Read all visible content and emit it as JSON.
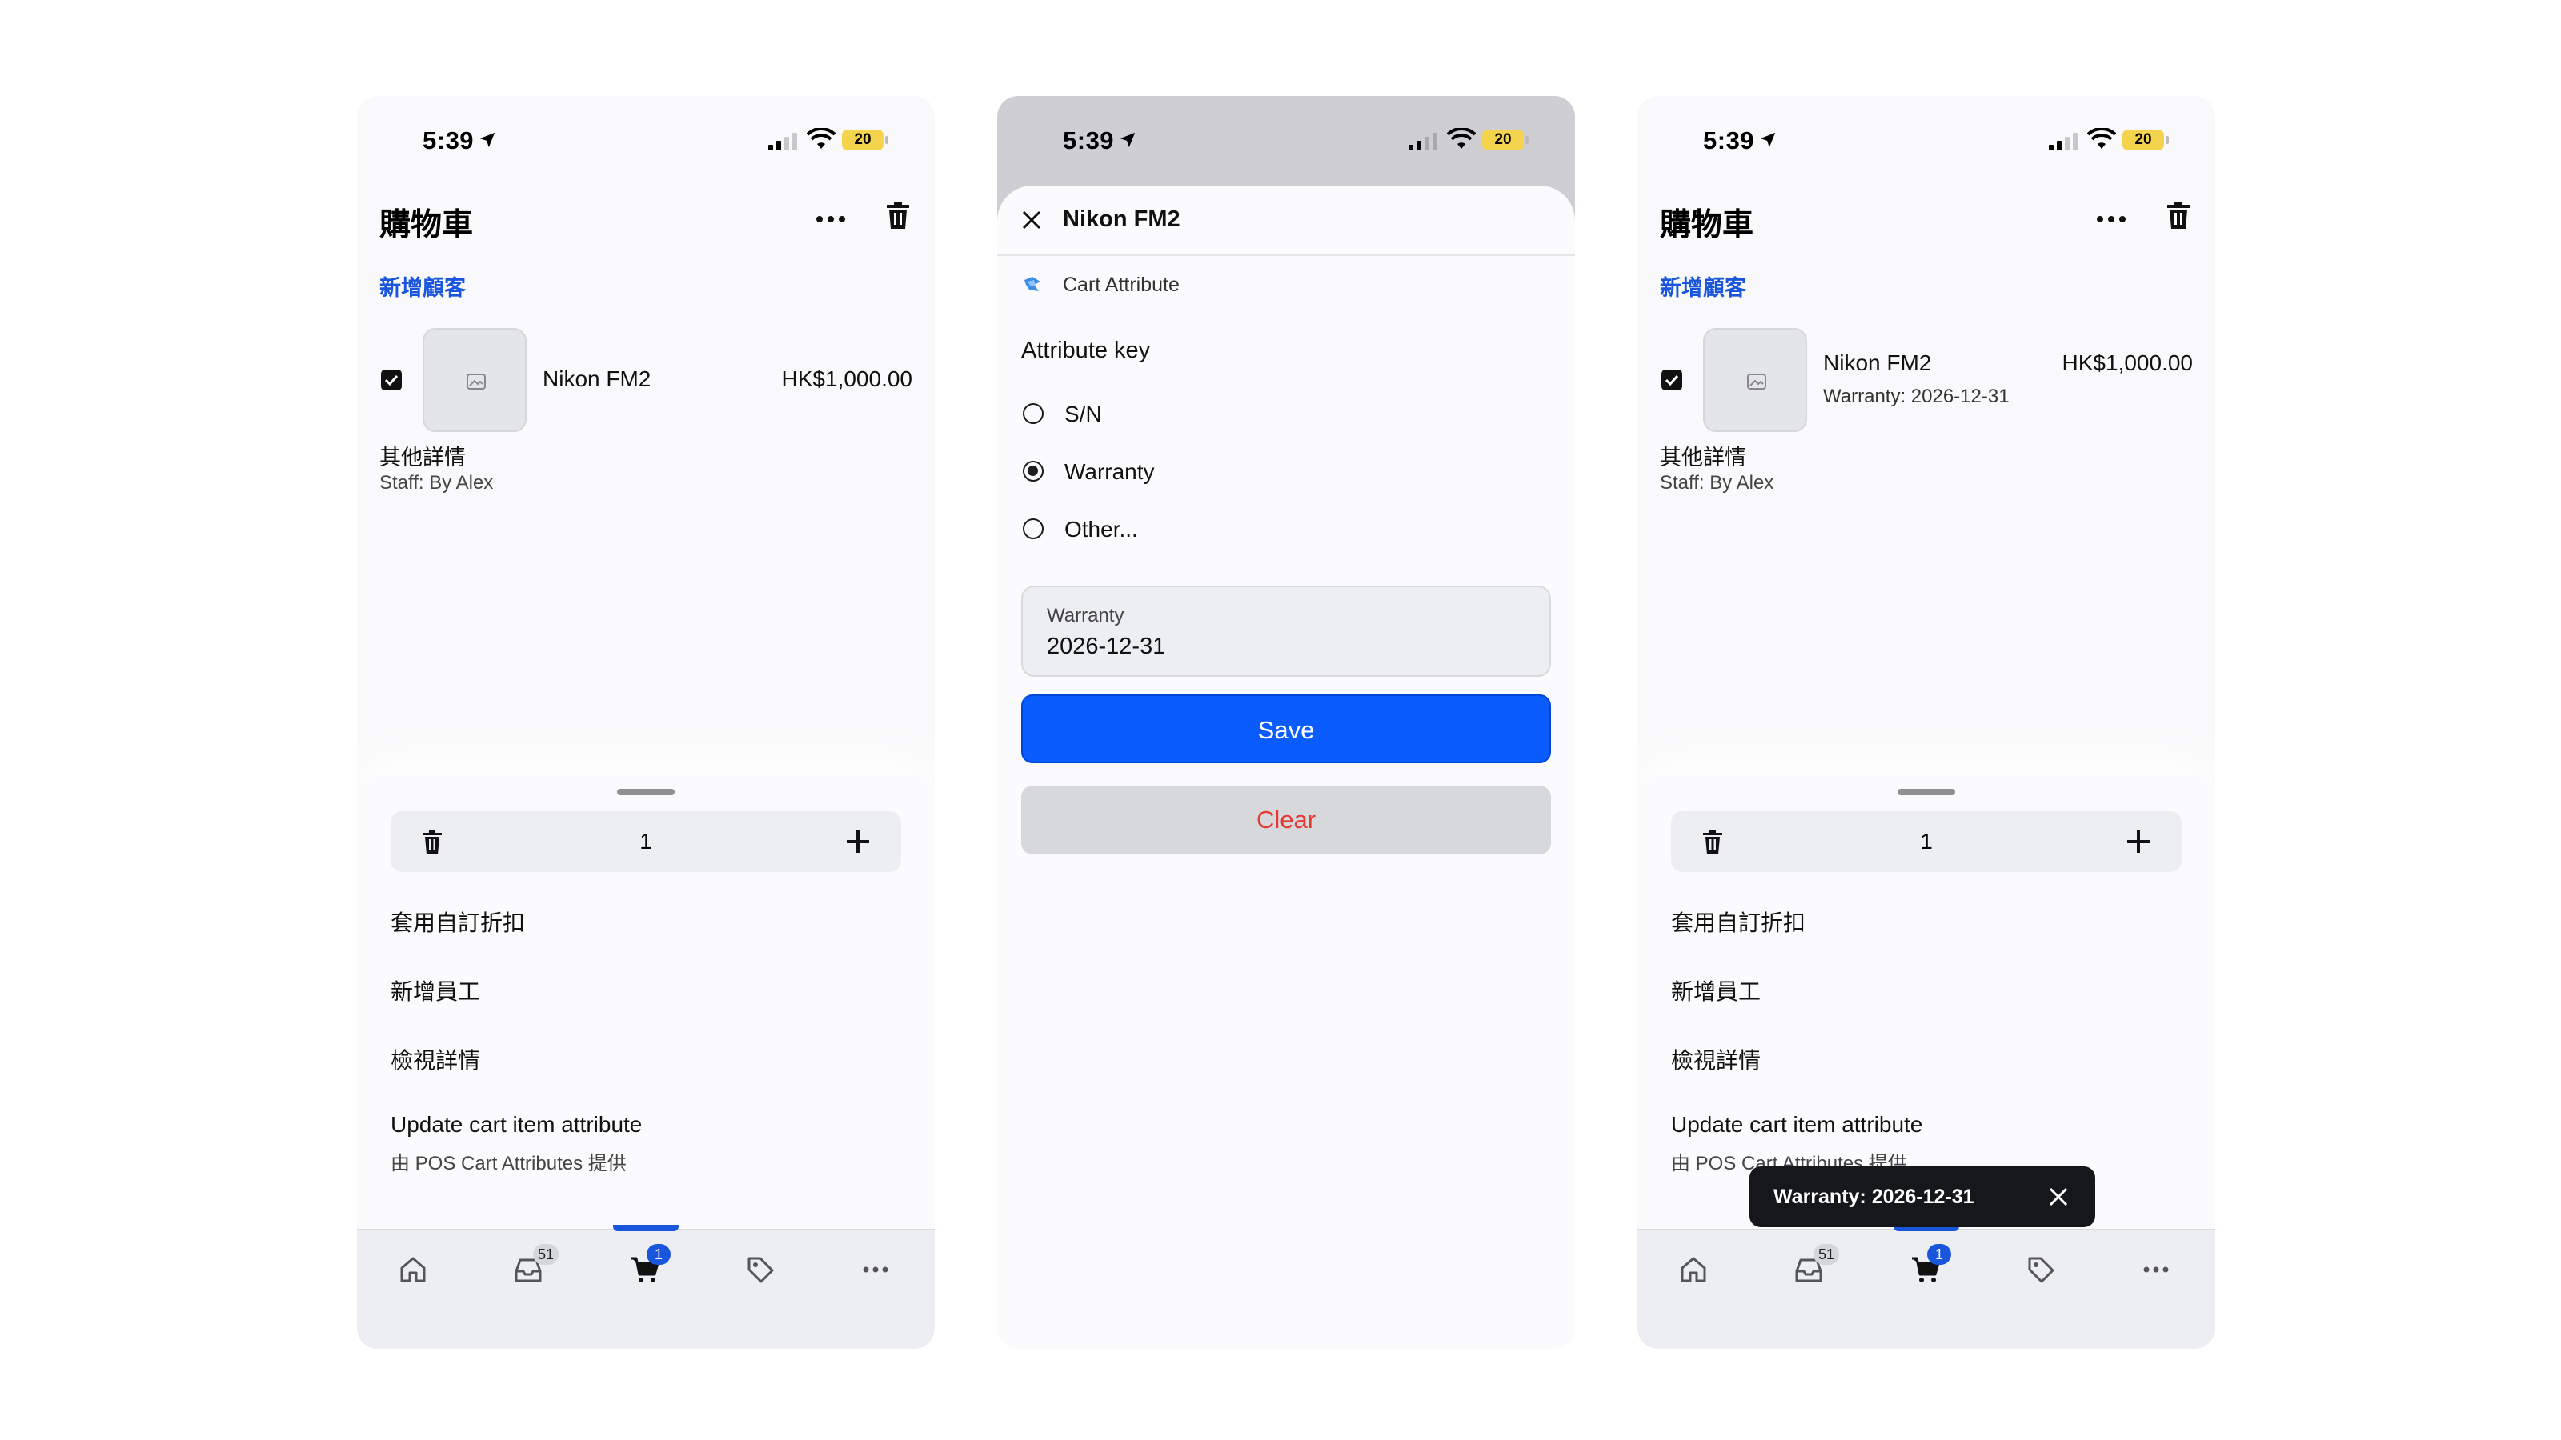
{
  "status": {
    "time": "5:39",
    "battery": "20"
  },
  "cart": {
    "title": "購物車",
    "add_customer": "新增顧客",
    "item": {
      "name": "Nikon FM2",
      "price": "HK$1,000.00",
      "attribute_line": "Warranty: 2026-12-31"
    },
    "details_label": "其他詳情",
    "details_staff": "Staff: By Alex"
  },
  "sheet": {
    "quantity": "1",
    "menu": [
      {
        "label": "套用自訂折扣"
      },
      {
        "label": "新增員工"
      },
      {
        "label": "檢視詳情"
      },
      {
        "label": "Update cart item attribute",
        "sub": "由 POS Cart Attributes 提供"
      }
    ]
  },
  "tabbar": {
    "tabs": [
      "home-icon",
      "inbox-icon",
      "cart-icon",
      "tag-icon",
      "more-icon"
    ],
    "inbox_badge": "51",
    "cart_badge": "1"
  },
  "modal": {
    "title": "Nikon FM2",
    "app_name": "Cart Attribute",
    "attr_key_label": "Attribute key",
    "options": [
      {
        "label": "S/N",
        "selected": false
      },
      {
        "label": "Warranty",
        "selected": true
      },
      {
        "label": "Other...",
        "selected": false
      }
    ],
    "field_label": "Warranty",
    "field_value": "2026-12-31",
    "save_label": "Save",
    "clear_label": "Clear"
  },
  "toast": {
    "message": "Warranty: 2026-12-31"
  },
  "colors": {
    "accent": "#0a5cff",
    "link": "#1a56db",
    "danger": "#e53935",
    "battery": "#f4d44c"
  }
}
